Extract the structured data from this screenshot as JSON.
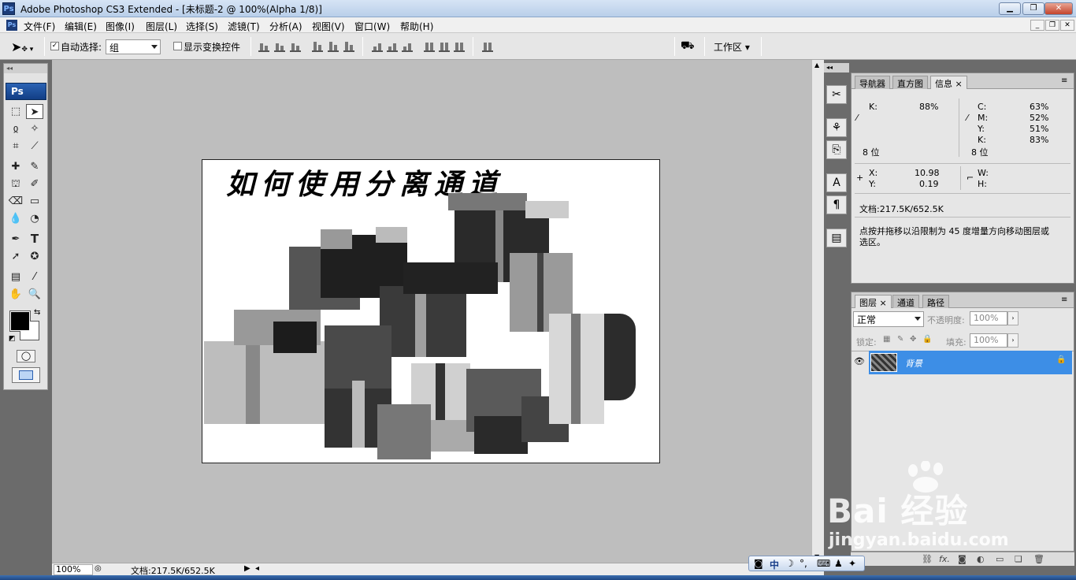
{
  "window": {
    "title": "Adobe Photoshop CS3 Extended - [未标题-2 @ 100%(Alpha 1/8)]",
    "app_icon": "Ps",
    "controls": [
      "minimize-icon",
      "restore-icon",
      "close-icon"
    ]
  },
  "menu": {
    "items": [
      "文件(F)",
      "编辑(E)",
      "图像(I)",
      "图层(L)",
      "选择(S)",
      "滤镜(T)",
      "分析(A)",
      "视图(V)",
      "窗口(W)",
      "帮助(H)"
    ]
  },
  "options": {
    "auto_select_label": "自动选择:",
    "auto_select_checked": true,
    "auto_select_value": "组",
    "show_transform_label": "显示变换控件",
    "show_transform_checked": false,
    "workspace_label": "工作区"
  },
  "toolbox": {
    "logo": "Ps",
    "foreground_color": "#000000",
    "background_color": "#ffffff"
  },
  "document": {
    "heading_text": "如何使用分离通道"
  },
  "status": {
    "zoom": "100%",
    "doc_info": "文档:217.5K/652.5K"
  },
  "info_panel": {
    "tabs": [
      "导航器",
      "直方图",
      "信息"
    ],
    "active_tab": "信息",
    "left": {
      "k_label": "K:",
      "k_value": "88%",
      "bits": "8 位"
    },
    "right": {
      "c_label": "C:",
      "c_value": "63%",
      "m_label": "M:",
      "m_value": "52%",
      "y_label": "Y:",
      "y_value": "51%",
      "k_label": "K:",
      "k_value": "83%",
      "bits": "8 位"
    },
    "coords": {
      "x_label": "X:",
      "x_value": "10.98",
      "y_label": "Y:",
      "y_value": "0.19",
      "w_label": "W:",
      "h_label": "H:"
    },
    "doc_info": "文档:217.5K/652.5K",
    "hint_line1": "点按并拖移以沿限制为 45 度增量方向移动图层或",
    "hint_line2": "选区。"
  },
  "layers_panel": {
    "tabs": [
      "图层",
      "通道",
      "路径"
    ],
    "active_tab": "图层",
    "blend_mode": "正常",
    "opacity_label": "不透明度:",
    "opacity_value": "100%",
    "lock_label": "锁定:",
    "fill_label": "填充:",
    "fill_value": "100%",
    "layers": [
      {
        "name": "背景",
        "selected": true,
        "locked": true
      }
    ]
  },
  "ime": {
    "label": "中"
  },
  "watermark": {
    "brand": "Bai 经验",
    "url": "jingyan.baidu.com"
  }
}
